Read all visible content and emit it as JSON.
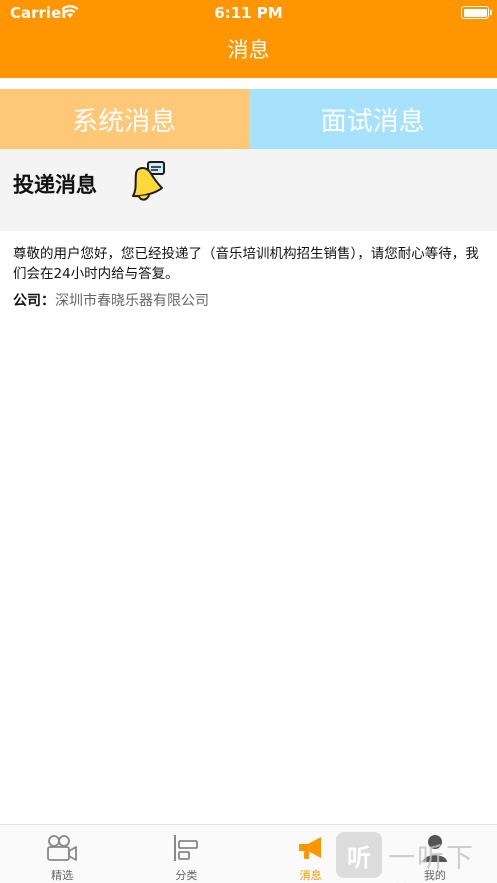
{
  "status_bar": {
    "carrier": "Carrier",
    "time": "6:11 PM"
  },
  "nav": {
    "title": "消息"
  },
  "tabs": [
    {
      "label": "系统消息"
    },
    {
      "label": "面试消息"
    }
  ],
  "delivery": {
    "title": "投递消息",
    "message": "尊敬的用户您好，您已经投递了（音乐培训机构招生销售），请您耐心等待，我们会在24小时内给与答复。",
    "company_label": "公司：",
    "company_value": "深圳市春晓乐器有限公司"
  },
  "tabbar": [
    {
      "label": "精选",
      "icon": "video-camera-icon"
    },
    {
      "label": "分类",
      "icon": "category-bars-icon"
    },
    {
      "label": "消息",
      "icon": "megaphone-icon",
      "active": true
    },
    {
      "label": "我的",
      "icon": "person-icon"
    }
  ],
  "watermark": {
    "badge": "听",
    "text": "一听下载"
  },
  "colors": {
    "accent": "#ff9500",
    "tab_system": "#ffc876",
    "tab_interview": "#a6e2fb",
    "section_bg": "#f4f4f4"
  }
}
